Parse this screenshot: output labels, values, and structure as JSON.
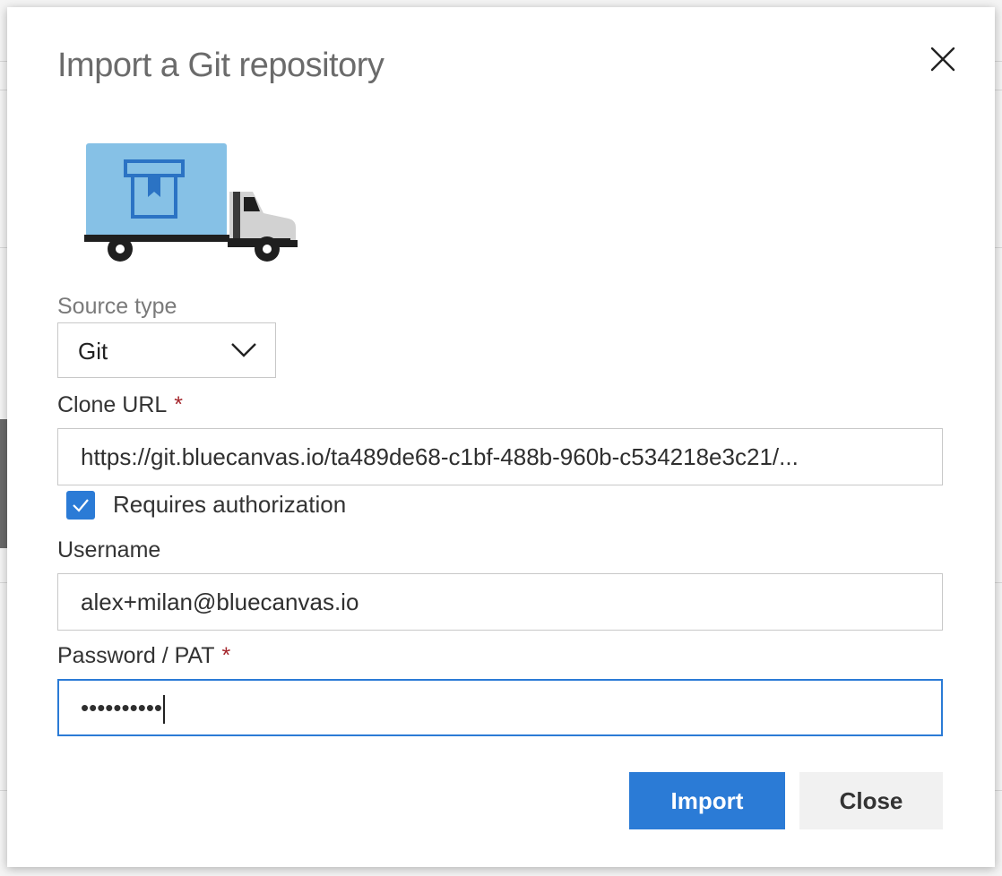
{
  "dialog": {
    "title": "Import a Git repository",
    "close_icon": "close-icon",
    "illustration": "delivery-truck-illustration"
  },
  "form": {
    "source_type": {
      "label": "Source type",
      "selected": "Git"
    },
    "clone_url": {
      "label": "Clone URL",
      "required_marker": "*",
      "value": "https://git.bluecanvas.io/ta489de68-c1bf-488b-960b-c534218e3c21/..."
    },
    "requires_authorization": {
      "label": "Requires authorization",
      "checked": true
    },
    "username": {
      "label": "Username",
      "value": "alex+milan@bluecanvas.io"
    },
    "password": {
      "label": "Password / PAT",
      "required_marker": "*",
      "masked_value": "••••••••••"
    }
  },
  "buttons": {
    "import_label": "Import",
    "close_label": "Close"
  },
  "colors": {
    "accent": "#2b7bd6",
    "required": "#a4262c",
    "truck_box": "#86c1e6",
    "truck_box_icon": "#2b73c4"
  }
}
